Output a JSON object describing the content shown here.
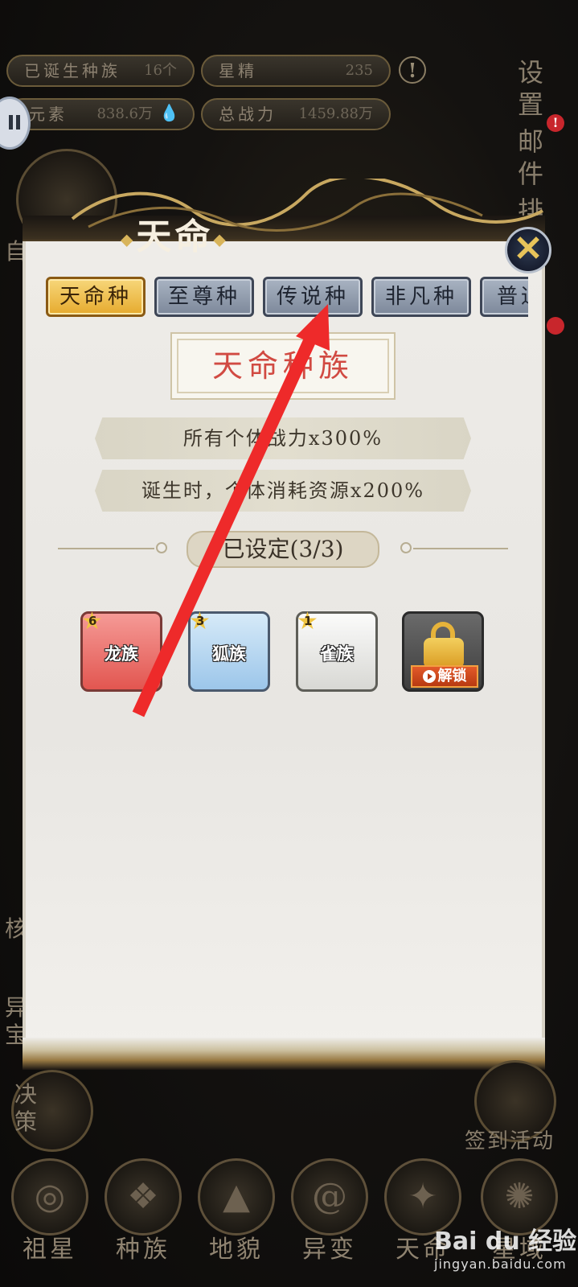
{
  "stats": {
    "born_races_label": "已诞生种族",
    "born_races_value": "16个",
    "star_essence_label": "星精",
    "star_essence_value": "235",
    "elements_label": "元素",
    "elements_value": "838.6万",
    "total_power_label": "总战力",
    "total_power_value": "1459.88万"
  },
  "side_right": {
    "settings": "设置",
    "mail": "邮件",
    "rank_partial": "排",
    "badge": "!"
  },
  "side_left": {
    "item1_partial": "自",
    "item2_partial": "核",
    "item3_partial": "异宝"
  },
  "dialog": {
    "title": "天命",
    "close_label": "✕",
    "tabs": [
      {
        "label": "天命种",
        "active": true
      },
      {
        "label": "至尊种",
        "active": false
      },
      {
        "label": "传说种",
        "active": false
      },
      {
        "label": "非凡种",
        "active": false
      },
      {
        "label": "普通种",
        "active": false
      }
    ],
    "race_name": "天命种族",
    "effects": [
      "所有个体战力x300%",
      "诞生时，个体消耗资源x200%"
    ],
    "set_label": "已设定(3/3)",
    "cards": [
      {
        "name": "龙族",
        "stars": "6"
      },
      {
        "name": "狐族",
        "stars": "3"
      },
      {
        "name": "雀族",
        "stars": "1"
      }
    ],
    "unlock_label": "解锁"
  },
  "decision_label": "决策",
  "signin_label": "签到活动",
  "bottom_nav": [
    {
      "label": "祖星",
      "icon": "planet-icon"
    },
    {
      "label": "种族",
      "icon": "race-icon"
    },
    {
      "label": "地貌",
      "icon": "terrain-icon"
    },
    {
      "label": "异变",
      "icon": "mutation-icon"
    },
    {
      "label": "天命",
      "icon": "destiny-icon"
    },
    {
      "label": "星域",
      "icon": "star-domain-icon"
    }
  ],
  "watermark": {
    "brand": "Bai du 经验",
    "url": "jingyan.baidu.com"
  },
  "colors": {
    "active_tab": "#e6aa2e",
    "inactive_tab": "#7d889a",
    "race_name": "#d14a42",
    "arrow": "#ee2a2a"
  }
}
